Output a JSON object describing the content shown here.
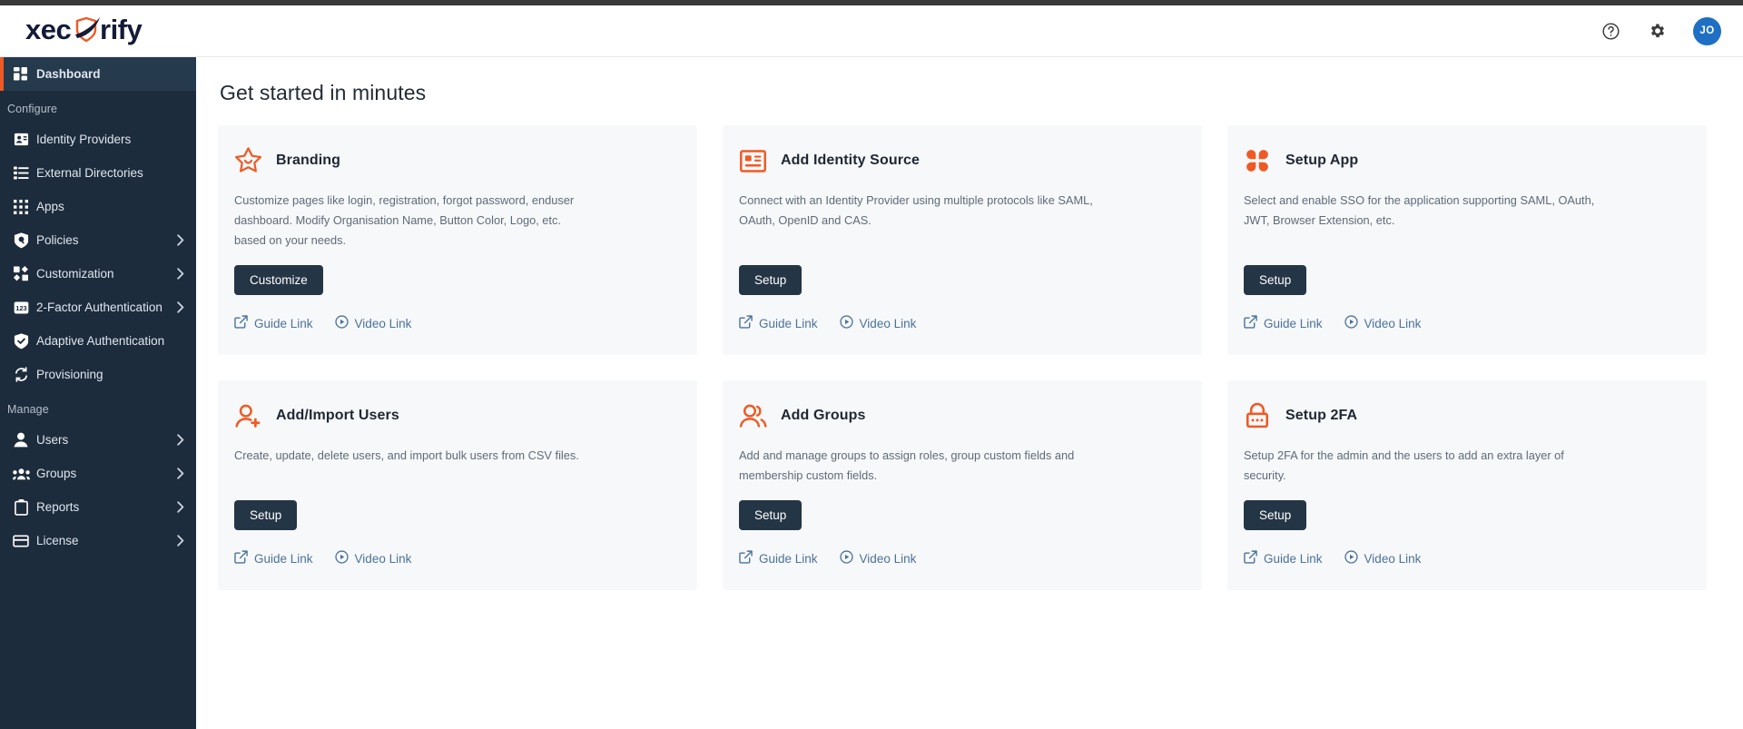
{
  "brand": {
    "name": "xecurify",
    "accent_color": "#ef5a24",
    "dark_color": "#1d2c3c"
  },
  "header": {
    "help_icon": "help-circle-icon",
    "settings_icon": "gear-icon",
    "avatar_initials": "JO",
    "avatar_color": "#1f6fc4"
  },
  "sidebar": {
    "items": [
      {
        "label": "Dashboard",
        "icon": "dashboard-icon",
        "active": true,
        "chevron": false
      },
      {
        "label": "Configure",
        "type": "section"
      },
      {
        "label": "Identity Providers",
        "icon": "id-badge-icon",
        "active": false,
        "chevron": false
      },
      {
        "label": "External Directories",
        "icon": "list-icon",
        "active": false,
        "chevron": false
      },
      {
        "label": "Apps",
        "icon": "grid-dots-icon",
        "active": false,
        "chevron": false
      },
      {
        "label": "Policies",
        "icon": "shield-search-icon",
        "active": false,
        "chevron": true
      },
      {
        "label": "Customization",
        "icon": "blocks-icon",
        "active": false,
        "chevron": true
      },
      {
        "label": "2-Factor Authentication",
        "icon": "numeric-123-icon",
        "active": false,
        "chevron": true
      },
      {
        "label": "Adaptive Authentication",
        "icon": "shield-check-icon",
        "active": false,
        "chevron": false
      },
      {
        "label": "Provisioning",
        "icon": "sync-icon",
        "active": false,
        "chevron": false
      },
      {
        "label": "Manage",
        "type": "section"
      },
      {
        "label": "Users",
        "icon": "user-icon",
        "active": false,
        "chevron": true
      },
      {
        "label": "Groups",
        "icon": "users-icon",
        "active": false,
        "chevron": true
      },
      {
        "label": "Reports",
        "icon": "clipboard-icon",
        "active": false,
        "chevron": true
      },
      {
        "label": "License",
        "icon": "card-icon",
        "active": false,
        "chevron": true
      }
    ]
  },
  "main": {
    "title": "Get started in minutes",
    "cards": [
      {
        "icon": "star-smile-icon",
        "title": "Branding",
        "description": "Customize pages like login, registration, forgot password, enduser dashboard. Modify Organisation Name, Button Color, Logo, etc. based on your needs.",
        "button": "Customize",
        "guide_link": "Guide Link",
        "video_link": "Video Link"
      },
      {
        "icon": "id-card-icon",
        "title": "Add Identity Source",
        "description": "Connect with an Identity Provider using multiple protocols like SAML, OAuth, OpenID and CAS.",
        "button": "Setup",
        "guide_link": "Guide Link",
        "video_link": "Video Link"
      },
      {
        "icon": "clover-apps-icon",
        "title": "Setup App",
        "description": "Select and enable SSO for the application supporting SAML, OAuth, JWT, Browser Extension, etc.",
        "button": "Setup",
        "guide_link": "Guide Link",
        "video_link": "Video Link"
      },
      {
        "icon": "user-add-icon",
        "title": "Add/Import Users",
        "description": "Create, update, delete users, and import bulk users from CSV files.",
        "button": "Setup",
        "guide_link": "Guide Link",
        "video_link": "Video Link"
      },
      {
        "icon": "user-group-icon",
        "title": "Add Groups",
        "description": "Add and manage groups to assign roles, group custom fields and membership custom fields.",
        "button": "Setup",
        "guide_link": "Guide Link",
        "video_link": "Video Link"
      },
      {
        "icon": "lock-dots-icon",
        "title": "Setup 2FA",
        "description": "Setup 2FA for the admin and the users to add an extra layer of security.",
        "button": "Setup",
        "guide_link": "Guide Link",
        "video_link": "Video Link"
      }
    ]
  }
}
